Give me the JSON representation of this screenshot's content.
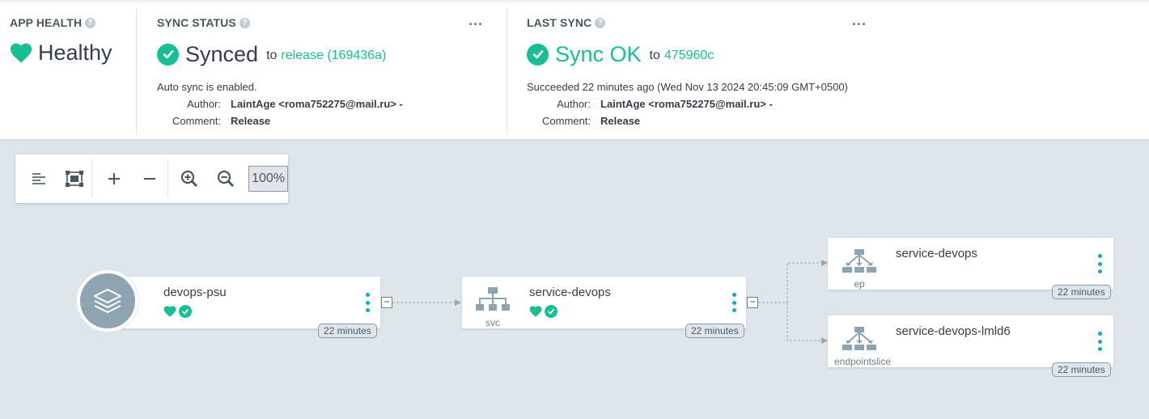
{
  "colors": {
    "accent": "#18be94",
    "kebab": "#0dadca",
    "canvas": "#dee6eb"
  },
  "app_health": {
    "title": "APP HEALTH",
    "status": "Healthy",
    "help_icon": "question-icon",
    "status_icon": "heart-icon"
  },
  "sync_status": {
    "title": "SYNC STATUS",
    "status": "Synced",
    "to": "to",
    "revision": "release (169436a)",
    "description": "Auto sync is enabled.",
    "author_label": "Author:",
    "author": "LaintAge <roma752275@mail.ru> -",
    "comment_label": "Comment:",
    "comment": "Release",
    "more": "..."
  },
  "last_sync": {
    "title": "LAST SYNC",
    "status": "Sync OK",
    "to": "to",
    "revision": "475960c",
    "description": "Succeeded 22 minutes ago (Wed Nov 13 2024 20:45:09 GMT+0500)",
    "author_label": "Author:",
    "author": "LaintAge <roma752275@mail.ru> -",
    "comment_label": "Comment:",
    "comment": "Release",
    "more": "..."
  },
  "toolbar": {
    "buttons": [
      "align-left-icon",
      "fit-screen-icon",
      "plus-icon",
      "minus-icon",
      "zoom-in-icon",
      "zoom-out-icon"
    ],
    "zoom": "100%"
  },
  "graph": {
    "app": {
      "name": "devops-psu",
      "age": "22 minutes",
      "icon": "layers-icon"
    },
    "service": {
      "name": "service-devops",
      "kind": "svc",
      "age": "22 minutes"
    },
    "endpoints": {
      "name": "service-devops",
      "kind": "ep",
      "age": "22 minutes"
    },
    "endpointslice": {
      "name": "service-devops-lmld6",
      "kind": "endpointslice",
      "age": "22 minutes"
    },
    "collapse_symbol": "−"
  }
}
